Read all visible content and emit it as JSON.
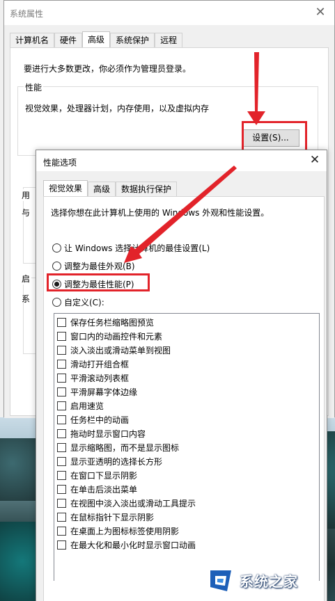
{
  "system_properties": {
    "title": "系统属性",
    "close_glyph": "✕",
    "tabs": [
      {
        "label": "计算机名",
        "active": false
      },
      {
        "label": "硬件",
        "active": false
      },
      {
        "label": "高级",
        "active": true
      },
      {
        "label": "系统保护",
        "active": false
      },
      {
        "label": "远程",
        "active": false
      }
    ],
    "notice": "要进行大多数更改，你必须作为管理员登录。",
    "performance_group": {
      "legend": "性能",
      "description": "视觉效果，处理器计划，内存使用，以及虚拟内存",
      "settings_button": "设置(S)..."
    },
    "user_profiles_group": {
      "legend": "用",
      "text": "与"
    },
    "startup_group": {
      "legend": "启",
      "text": "系"
    }
  },
  "performance_options": {
    "title": "性能选项",
    "close_glyph": "✕",
    "tabs": [
      {
        "label": "视觉效果",
        "active": true
      },
      {
        "label": "高级",
        "active": false
      },
      {
        "label": "数据执行保护",
        "active": false
      }
    ],
    "instruction": "选择你想在此计算机上使用的 Windows 外观和性能设置。",
    "options": [
      {
        "label": "让 Windows 选择计算机的最佳设置(L)",
        "checked": false
      },
      {
        "label": "调整为最佳外观(B)",
        "checked": false
      },
      {
        "label": "调整为最佳性能(P)",
        "checked": true
      },
      {
        "label": "自定义(C):",
        "checked": false
      }
    ],
    "effects": [
      "保存任务栏缩略图预览",
      "窗口内的动画控件和元素",
      "淡入淡出或滑动菜单到视图",
      "滑动打开组合框",
      "平滑滚动列表框",
      "平滑屏幕字体边缘",
      "启用速览",
      "任务栏中的动画",
      "拖动时显示窗口内容",
      "显示缩略图，而不是显示图标",
      "显示亚透明的选择长方形",
      "在窗口下显示阴影",
      "在单击后淡出菜单",
      "在视图中淡入淡出或滑动工具提示",
      "在鼠标指针下显示阴影",
      "在桌面上为图标标签使用阴影",
      "在最大化和最小化时显示窗口动画"
    ]
  },
  "watermark": {
    "text": "系统之家"
  },
  "colors": {
    "highlight_red": "#e2232a",
    "window_bg": "#f0f0f0"
  }
}
